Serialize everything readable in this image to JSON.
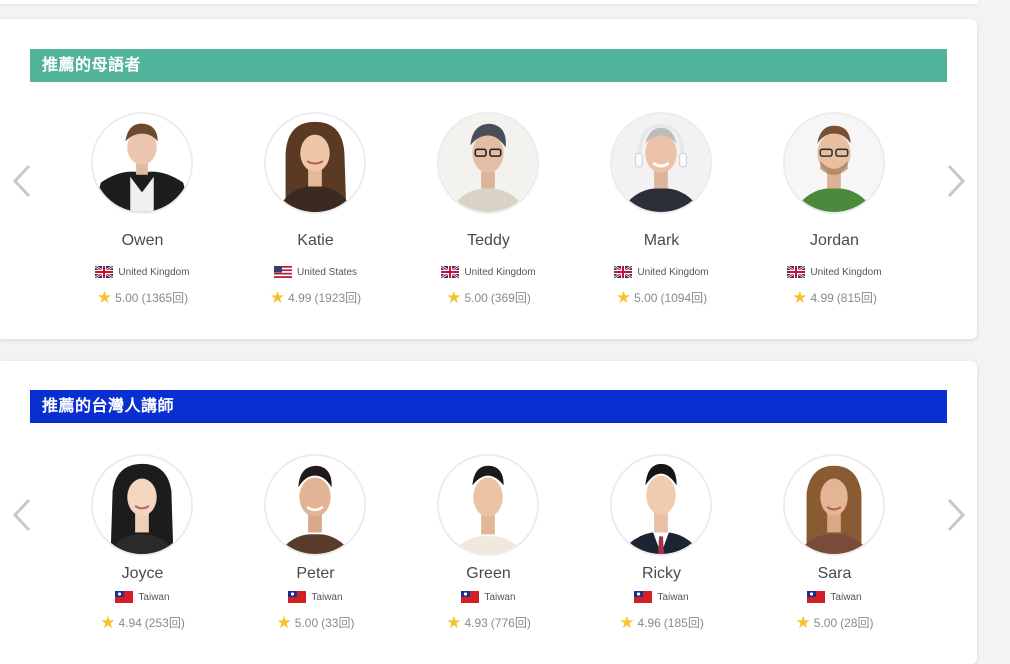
{
  "sections": [
    {
      "title": "推薦的母語者",
      "header_color": "#52b39b",
      "tutors": [
        {
          "name": "Owen",
          "country": "United Kingdom",
          "flag": "uk-flag-icon",
          "rating": "5.00",
          "count": "(1365回)"
        },
        {
          "name": "Katie",
          "country": "United States",
          "flag": "us-flag-icon",
          "rating": "4.99",
          "count": "(1923回)"
        },
        {
          "name": "Teddy",
          "country": "United Kingdom",
          "flag": "uk-flag-icon",
          "rating": "5.00",
          "count": "(369回)"
        },
        {
          "name": "Mark",
          "country": "United Kingdom",
          "flag": "uk-flag-icon",
          "rating": "5.00",
          "count": "(1094回)"
        },
        {
          "name": "Jordan",
          "country": "United Kingdom",
          "flag": "uk-flag-icon",
          "rating": "4.99",
          "count": "(815回)"
        }
      ]
    },
    {
      "title": "推薦的台灣人講師",
      "header_color": "#0a2fd1",
      "tutors": [
        {
          "name": "Joyce",
          "country": "Taiwan",
          "flag": "taiwan-flag-icon",
          "rating": "4.94",
          "count": "(253回)"
        },
        {
          "name": "Peter",
          "country": "Taiwan",
          "flag": "taiwan-flag-icon",
          "rating": "5.00",
          "count": "(33回)"
        },
        {
          "name": "Green",
          "country": "Taiwan",
          "flag": "taiwan-flag-icon",
          "rating": "4.93",
          "count": "(776回)"
        },
        {
          "name": "Ricky",
          "country": "Taiwan",
          "flag": "taiwan-flag-icon",
          "rating": "4.96",
          "count": "(185回)"
        },
        {
          "name": "Sara",
          "country": "Taiwan",
          "flag": "taiwan-flag-icon",
          "rating": "5.00",
          "count": "(28回)"
        }
      ]
    }
  ],
  "icons": {
    "prev": "chevron-left-icon",
    "next": "chevron-right-icon",
    "star": "star-icon"
  },
  "colors": {
    "star": "#f4c430",
    "arrow": "#c8c8c8"
  }
}
